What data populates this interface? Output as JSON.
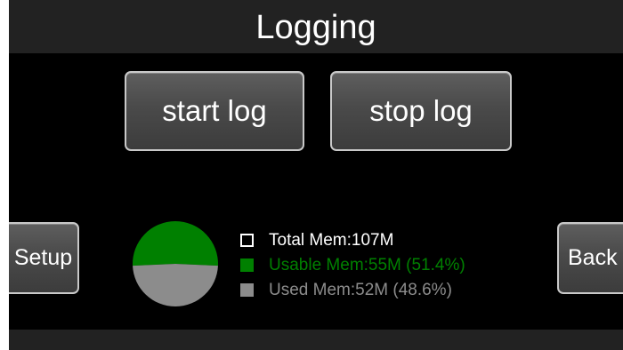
{
  "header": {
    "title": "Logging"
  },
  "actions": {
    "start_label": "start log",
    "stop_label": "stop log"
  },
  "nav": {
    "setup_label": "Setup",
    "back_label": "Back"
  },
  "memory": {
    "total_label": "Total Mem:107M",
    "usable_label": "Usable Mem:55M (51.4%)",
    "used_label": "Used Mem:52M (48.6%)",
    "usable_percent": 51.4,
    "used_percent": 48.6
  },
  "colors": {
    "usable": "#008000",
    "used": "#8c8c8c",
    "total_swatch_border": "#ffffff",
    "text_white": "#ffffff",
    "text_green": "#008000",
    "text_gray": "#8c8c8c"
  }
}
